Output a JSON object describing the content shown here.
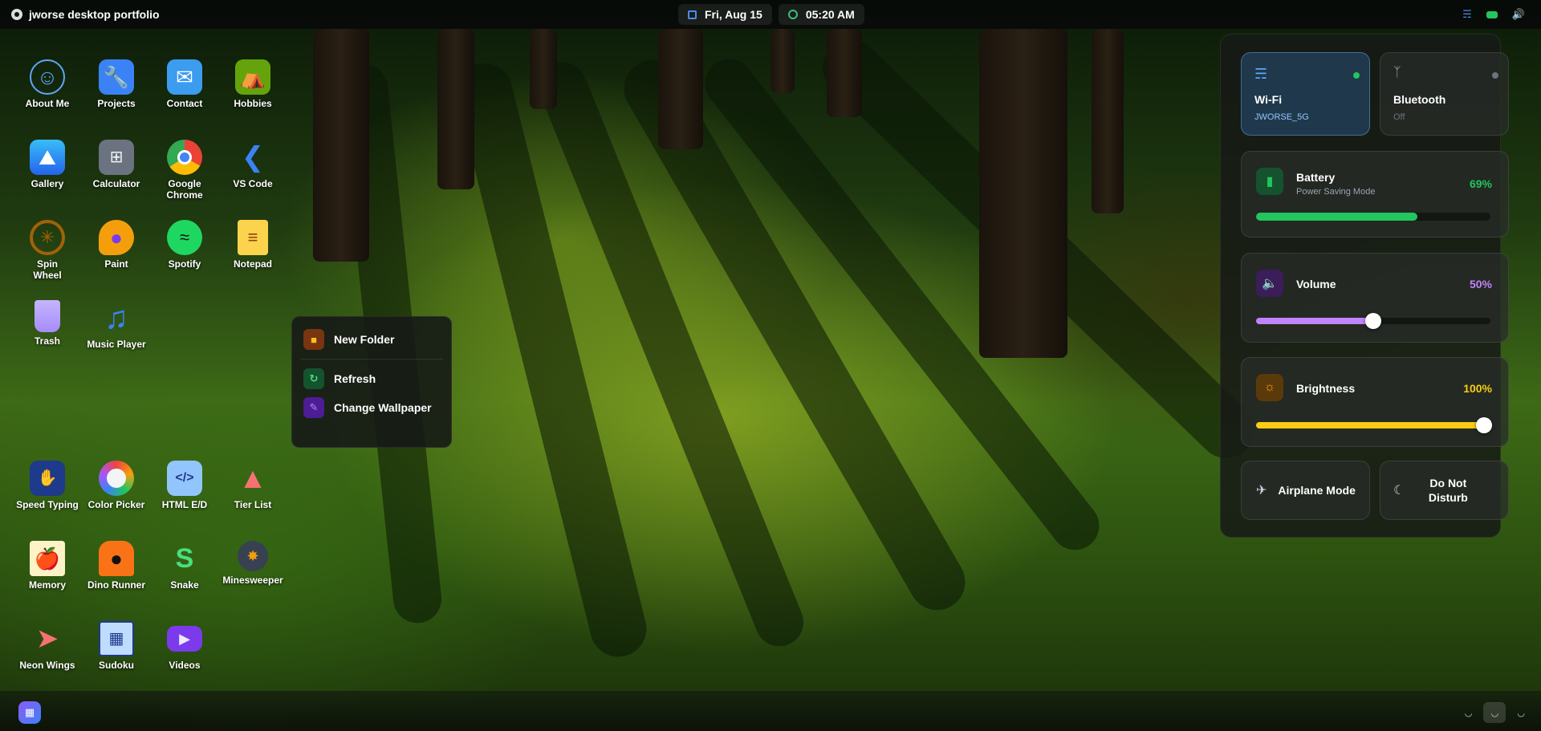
{
  "topbar": {
    "title": "jworse desktop portfolio",
    "date": "Fri, Aug 15",
    "time": "05:20 AM",
    "tray_icons": [
      "wifi-icon",
      "battery-icon",
      "volume-icon"
    ]
  },
  "desktop_icons": [
    {
      "label": "About Me",
      "icon": "user-icon"
    },
    {
      "label": "Projects",
      "icon": "folder-tools-icon"
    },
    {
      "label": "Contact",
      "icon": "mail-icon"
    },
    {
      "label": "Hobbies",
      "icon": "tent-icon"
    },
    {
      "label": "Gallery",
      "icon": "image-icon"
    },
    {
      "label": "Calculator",
      "icon": "calculator-icon"
    },
    {
      "label": "Google Chrome",
      "icon": "chrome-icon"
    },
    {
      "label": "VS Code",
      "icon": "vscode-icon"
    },
    {
      "label": "Spin Wheel",
      "icon": "wheel-icon"
    },
    {
      "label": "Paint",
      "icon": "palette-icon"
    },
    {
      "label": "Spotify",
      "icon": "spotify-icon"
    },
    {
      "label": "Notepad",
      "icon": "notepad-icon"
    },
    {
      "label": "Trash",
      "icon": "trash-icon"
    },
    {
      "label": "Music Player",
      "icon": "music-icon"
    },
    {
      "label": "Speed Typing",
      "icon": "keyboard-icon"
    },
    {
      "label": "Color Picker",
      "icon": "color-wheel-icon"
    },
    {
      "label": "HTML E/D",
      "icon": "code-icon"
    },
    {
      "label": "Tier List",
      "icon": "pyramid-icon"
    },
    {
      "label": "Memory",
      "icon": "cards-icon"
    },
    {
      "label": "Dino Runner",
      "icon": "dino-icon"
    },
    {
      "label": "Snake",
      "icon": "snake-icon"
    },
    {
      "label": "Minesweeper",
      "icon": "bomb-icon"
    },
    {
      "label": "Neon Wings",
      "icon": "rocket-icon"
    },
    {
      "label": "Sudoku",
      "icon": "sudoku-icon"
    },
    {
      "label": "Videos",
      "icon": "video-icon"
    }
  ],
  "context_menu": {
    "new_folder": "New Folder",
    "refresh": "Refresh",
    "change_wallpaper": "Change Wallpaper"
  },
  "control_center": {
    "wifi": {
      "label": "Wi-Fi",
      "network": "JWORSE_5G",
      "on": true
    },
    "bluetooth": {
      "label": "Bluetooth",
      "status": "Off",
      "on": false
    },
    "battery": {
      "label": "Battery",
      "mode": "Power Saving Mode",
      "percent_text": "69%",
      "level": 0.69,
      "color": "#22c55e"
    },
    "volume": {
      "label": "Volume",
      "percent_text": "50%",
      "level": 0.5,
      "color": "#c084fc"
    },
    "brightness": {
      "label": "Brightness",
      "percent_text": "100%",
      "level": 1.0,
      "color": "#facc15"
    },
    "airplane": {
      "label": "Airplane Mode"
    },
    "dnd": {
      "label": "Do Not Disturb"
    }
  },
  "colors": {
    "wifi_accent": "#3b82f6",
    "wifi_dot": "#22c55e",
    "battery_accent": "#22c55e",
    "volume_accent": "#c084fc",
    "brightness_accent": "#facc15"
  }
}
